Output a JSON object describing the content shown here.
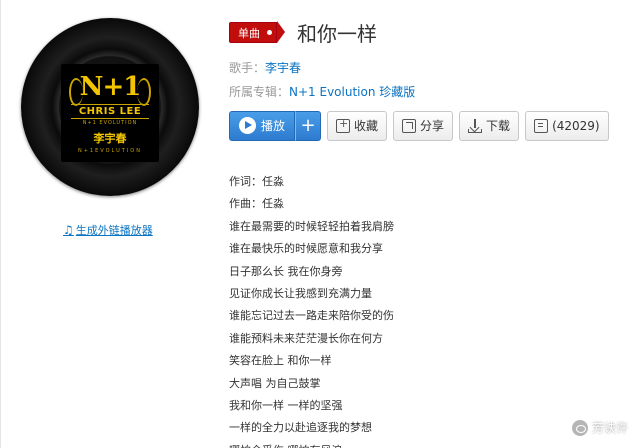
{
  "cover": {
    "logo_text": "N+1",
    "logo_name": "CHRIS LEE",
    "logo_sub": "N+1 EVOLUTION",
    "logo_cn": "李宇春",
    "logo_ev": "N+1EVOLUTION"
  },
  "external_player_link": "生成外链播放器",
  "badge": "单曲",
  "song_title": "和你一样",
  "singer_label": "歌手：",
  "singer": "李宇春",
  "album_label": "所属专辑：",
  "album": "N+1 Evolution 珍藏版",
  "buttons": {
    "play": "播放",
    "add": "+",
    "favorite": "收藏",
    "share": "分享",
    "download": "下载",
    "comments": "(42029)"
  },
  "lyrics": [
    "作词：任淼",
    "作曲：任淼",
    "谁在最需要的时候轻轻拍着我肩膀",
    "谁在最快乐的时候愿意和我分享",
    "日子那么长 我在你身旁",
    "见证你成长让我感到充满力量",
    "谁能忘记过去一路走来陪你受的伤",
    "谁能预料未来茫茫漫长你在何方",
    "笑容在脸上 和你一样",
    "大声唱 为自己鼓掌",
    "我和你一样 一样的坚强",
    "一样的全力以赴追逐我的梦想",
    "哪怕会受伤 哪怕有风浪"
  ],
  "watermark": "芳诀许"
}
